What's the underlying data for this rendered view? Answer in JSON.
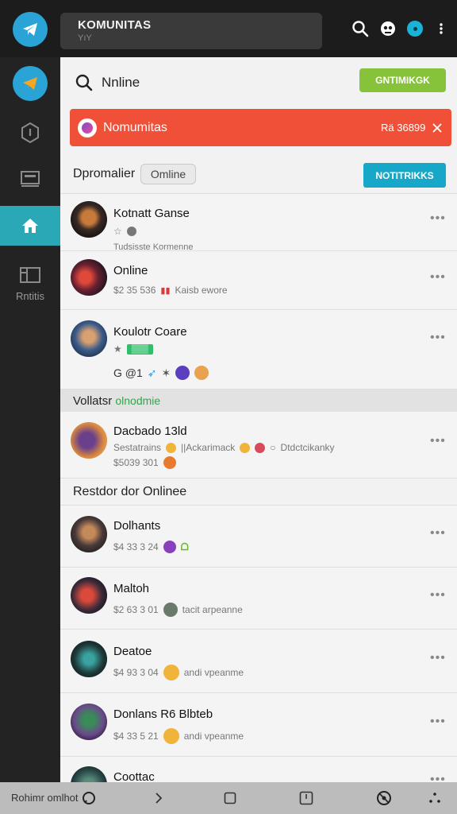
{
  "topbar": {
    "title": "KOMUNITAS",
    "subtitle": "YıY",
    "icons": [
      "search-icon",
      "game-controller-icon",
      "status-dot-icon",
      "more-vertical-icon"
    ]
  },
  "sidebar": {
    "items": [
      {
        "icon": "paper-plane-icon",
        "label": ""
      },
      {
        "icon": "shield-icon",
        "label": ""
      },
      {
        "icon": "monitor-icon",
        "label": ""
      },
      {
        "icon": "home-icon",
        "label": ""
      },
      {
        "icon": "cards-icon",
        "label": "Rntitis"
      }
    ]
  },
  "search": {
    "value": "Nnline",
    "button": "GNTIMIKGK"
  },
  "banner": {
    "title": "Nomumitas",
    "count": "Rä 36899"
  },
  "filter": {
    "label": "Dpromalier",
    "chip": "Omline",
    "button": "NOTITRIKKS"
  },
  "items1": [
    {
      "title": "Kotnatt Ganse",
      "sub": "☆",
      "meta": "Tudsisste Kormenne"
    },
    {
      "title": "Online",
      "sub": "$2 35  536",
      "sub2": "Kaisb ewore"
    },
    {
      "title": "Koulotr Coare",
      "sub": "★",
      "tag": "▒▒▒",
      "meta": "G  @1"
    }
  ],
  "section1": {
    "a": "Vollatsr",
    "b": "olnodmie"
  },
  "item4": {
    "title": "Dacbado 13ld",
    "sub": "Sestatrains",
    "sub2": "||Ackarimack",
    "sub3": "Dtdctcikanky",
    "meta": "$5039 301"
  },
  "section2": "Restdor dor Onlinee",
  "items2": [
    {
      "title": "Dolhants",
      "sub": "$4 33 3 24",
      "sub2": ""
    },
    {
      "title": "Maltoh",
      "sub": "$2 63 3 01",
      "sub2": "tacit arpeanne"
    },
    {
      "title": "Deatoe",
      "sub": "$4 93 3 04",
      "sub2": "andi vpeanme"
    },
    {
      "title": "Donlans R6 Blbteb",
      "sub": "$4 33 5 21",
      "sub2": "andi vpeanme"
    },
    {
      "title": "Coottac",
      "sub": "",
      "sub2": ""
    }
  ],
  "bottombar": {
    "label": "Rohimr omlhot",
    "icons": [
      "chat-icon",
      "chevron-right-icon",
      "square-icon",
      "edit-icon",
      "steering-icon",
      "more-icon"
    ]
  },
  "colors": {
    "accent_teal": "#2ba8b5",
    "banner_red": "#f05038",
    "button_green": "#86c23a",
    "button_teal": "#17a8c9"
  }
}
